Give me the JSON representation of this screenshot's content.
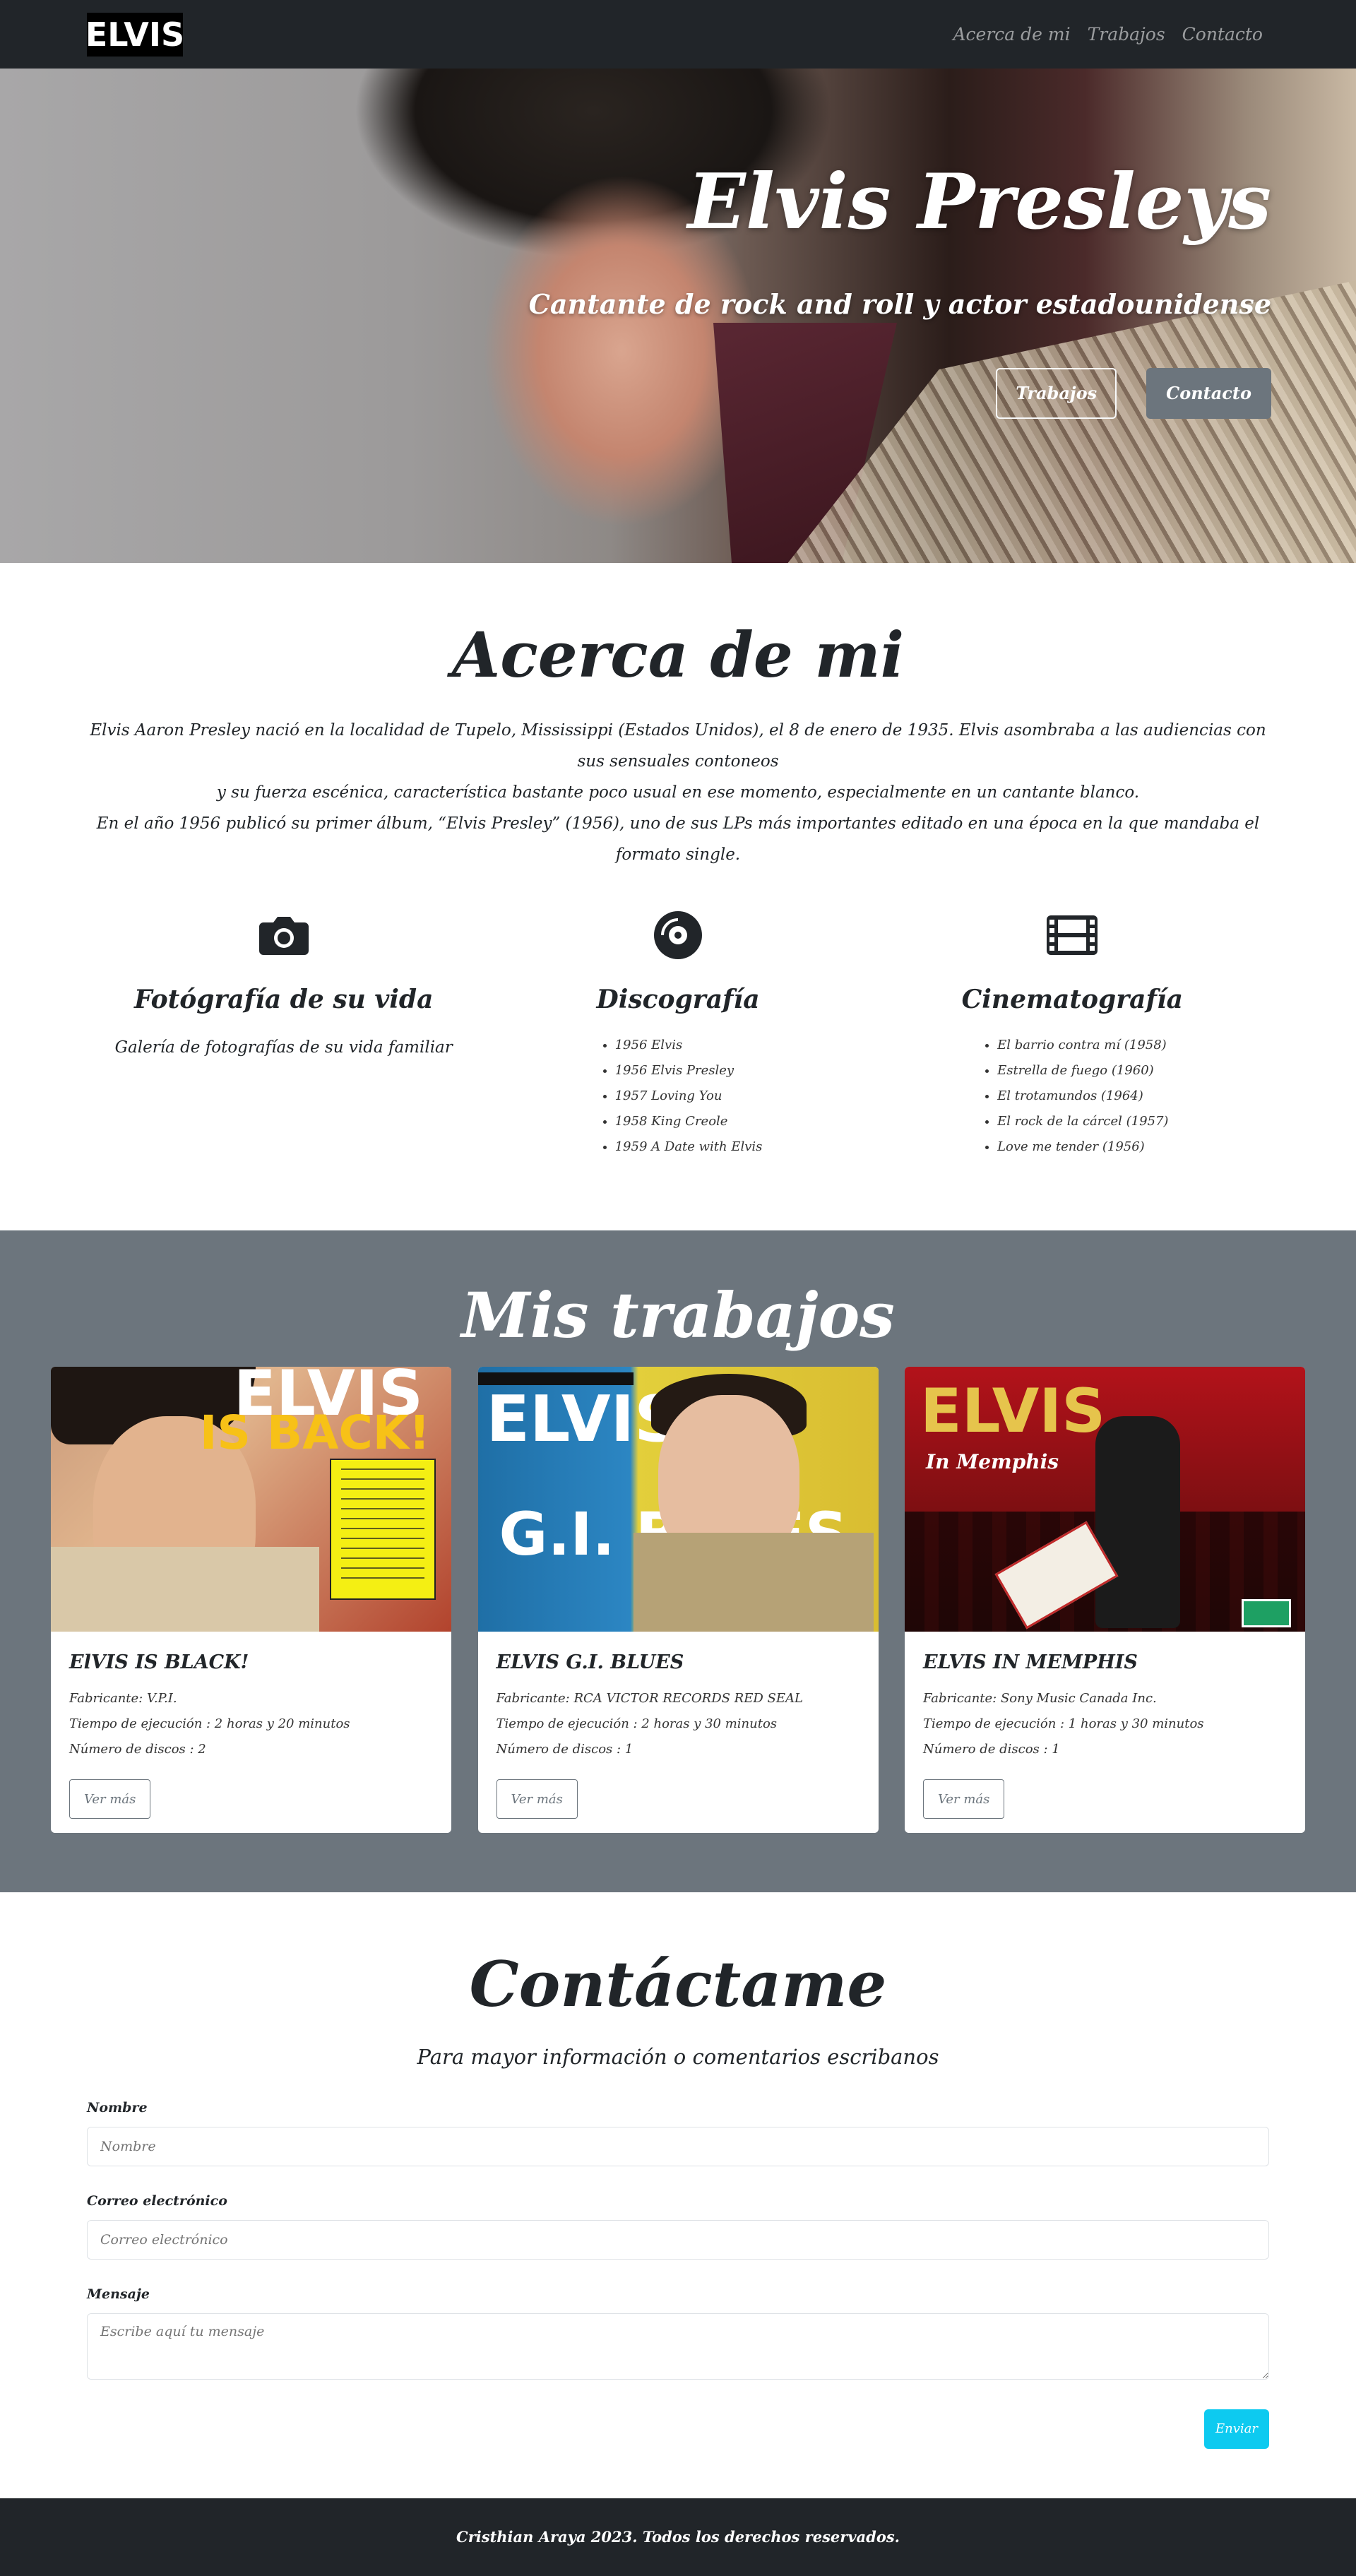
{
  "nav": {
    "brand": "ELVIS",
    "links": [
      "Acerca de mi",
      "Trabajos",
      "Contacto"
    ]
  },
  "hero": {
    "title": "Elvis Presleys",
    "subtitle": "Cantante de rock and roll y actor estadounidense",
    "buttons": [
      "Trabajos",
      "Contacto"
    ]
  },
  "about": {
    "title": "Acerca de mi",
    "text": [
      "Elvis Aaron Presley nació en la localidad de Tupelo, Mississippi (Estados Unidos), el 8 de enero de 1935. Elvis asombraba a las audiencias con sus sensuales contoneos",
      "y su fuerza escénica, característica bastante poco usual en ese momento, especialmente en un cantante blanco.",
      "En el año 1956 publicó su primer álbum, “Elvis Presley” (1956), uno de sus LPs más importantes editado en una época en la que mandaba el formato single."
    ],
    "features": [
      {
        "icon": "camera-icon",
        "title": "Fotógrafía de su vida",
        "description": "Galería de fotografías de su vida familiar"
      },
      {
        "icon": "vinyl-record-icon",
        "title": "Discografía",
        "items": [
          "1956 Elvis",
          "1956 Elvis Presley",
          "1957 Loving You",
          "1958 King Creole",
          "1959 A Date with Elvis"
        ]
      },
      {
        "icon": "film-icon",
        "title": "Cinematografía",
        "items": [
          "El barrio contra mí (1958)",
          "Estrella de fuego (1960)",
          "El trotamundos (1964)",
          "El rock de la cárcel (1957)",
          "Love me tender (1956)"
        ]
      }
    ]
  },
  "works": {
    "title": "Mis trabajos",
    "cards": [
      {
        "title": "ElVIS IS BLACK!",
        "maker": "Fabricante: V.P.I.",
        "duration": "Tiempo de ejecución : 2 horas y 20 minutos",
        "discs": "Número de discos : 2",
        "button": "Ver más",
        "art_text_1": "ELVIS",
        "art_text_2": "IS BACK!"
      },
      {
        "title": "ELVIS G.I. BLUES",
        "maker": "Fabricante: RCA VICTOR RECORDS RED SEAL",
        "duration": "Tiempo de ejecución : 2 horas y 30 minutos",
        "discs": "Número de discos : 1",
        "button": "Ver más",
        "art_text_1": "ELVIS",
        "art_text_2": "G.I. BLUES"
      },
      {
        "title": "ELVIS IN MEMPHIS",
        "maker": "Fabricante: Sony Music Canada Inc.",
        "duration": "Tiempo de ejecución : 1 horas y 30 minutos",
        "discs": "Número de discos : 1",
        "button": "Ver más",
        "art_text_1": "ELVIS",
        "art_text_2": "In Memphis"
      }
    ]
  },
  "contact": {
    "title": "Contáctame",
    "intro": "Para mayor información o comentarios escribanos",
    "fields": [
      {
        "label": "Nombre",
        "placeholder": "Nombre"
      },
      {
        "label": "Correo electrónico",
        "placeholder": "Correo electrónico"
      },
      {
        "label": "Mensaje",
        "placeholder": "Escribe aquí tu mensaje"
      }
    ],
    "submit": "Enviar"
  },
  "footer": {
    "text": "Cristhian Araya 2023. Todos los derechos reservados."
  },
  "colors": {
    "navbar": "#212529",
    "works_bg": "#6c757d",
    "submit": "#0dcaf0"
  }
}
